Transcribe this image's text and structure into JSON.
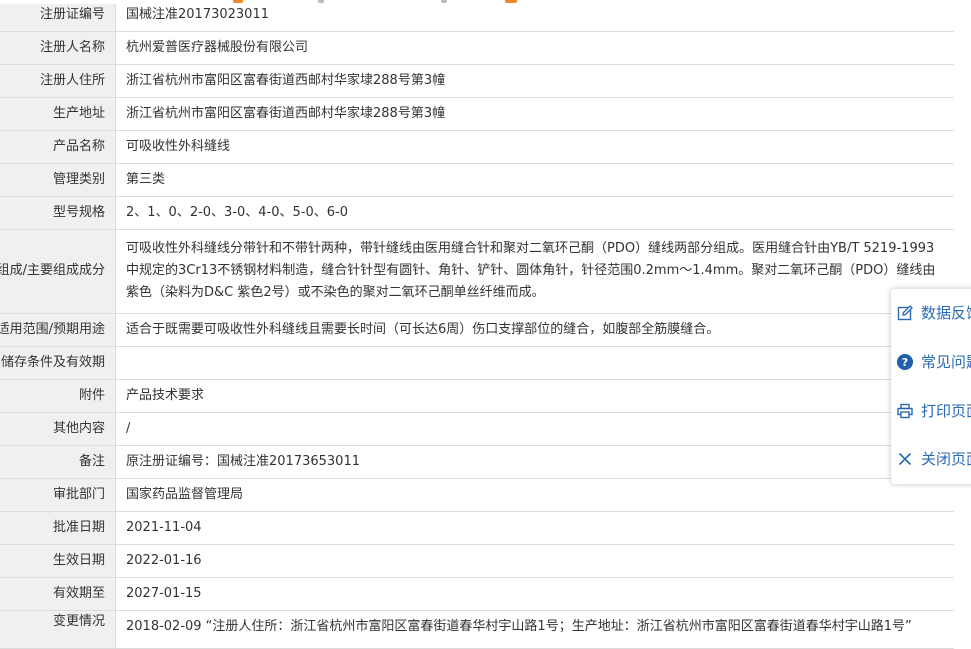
{
  "rows": [
    {
      "key": "注册证编号",
      "value": "国械注准20173023011"
    },
    {
      "key": "注册人名称",
      "value": "杭州爱普医疗器械股份有限公司"
    },
    {
      "key": "注册人住所",
      "value": "浙江省杭州市富阳区富春街道西邮村华家埭288号第3幢"
    },
    {
      "key": "生产地址",
      "value": "浙江省杭州市富阳区富春街道西邮村华家埭288号第3幢"
    },
    {
      "key": "产品名称",
      "value": "可吸收性外科缝线"
    },
    {
      "key": "管理类别",
      "value": "第三类"
    },
    {
      "key": "型号规格",
      "value": "2、1、0、2-0、3-0、4-0、5-0、6-0"
    },
    {
      "key": "结构及组成/主要组成成分",
      "value": "可吸收性外科缝线分带针和不带针两种，带针缝线由医用缝合针和聚对二氧环己酮（PDO）缝线两部分组成。医用缝合针由YB/T 5219-1993 中规定的3Cr13不锈钢材料制造，缝合针针型有圆针、角针、铲针、圆体角针，针径范围0.2mm～1.4mm。聚对二氧环己酮（PDO）缝线由紫色（染料为D&C 紫色2号）或不染色的聚对二氧环己酮单丝纤维而成。"
    },
    {
      "key": "适用范围/预期用途",
      "value": "适合于既需要可吸收性外科缝线且需要长时间（可长达6周）伤口支撑部位的缝合，如腹部全筋膜缝合。"
    },
    {
      "key": "产品储存条件及有效期",
      "value": ""
    },
    {
      "key": "附件",
      "value": "产品技术要求"
    },
    {
      "key": "其他内容",
      "value": "/"
    },
    {
      "key": "备注",
      "value": "原注册证编号：国械注准20173653011"
    },
    {
      "key": "审批部门",
      "value": "国家药品监督管理局"
    },
    {
      "key": "批准日期",
      "value": "2021-11-04"
    },
    {
      "key": "生效日期",
      "value": "2022-01-16"
    },
    {
      "key": "有效期至",
      "value": "2027-01-15"
    },
    {
      "key": "变更情况",
      "value": "2018-02-09 “注册人住所：浙江省杭州市富阳区富春街道春华村宇山路1号；生产地址：浙江省杭州市富阳区富春街道春华村宇山路1号”"
    }
  ],
  "side_panel": {
    "feedback": "数据反馈",
    "faq": "常见问题",
    "print": "打印页面",
    "close": "关闭页面"
  },
  "colors": {
    "accent": "#2b6ab3",
    "key_bg": "#f0f0f0",
    "border": "#dcdcdc",
    "topbar_orange": "#f08a24"
  },
  "icons": [
    "edit-icon",
    "question-icon",
    "print-icon",
    "close-icon"
  ]
}
